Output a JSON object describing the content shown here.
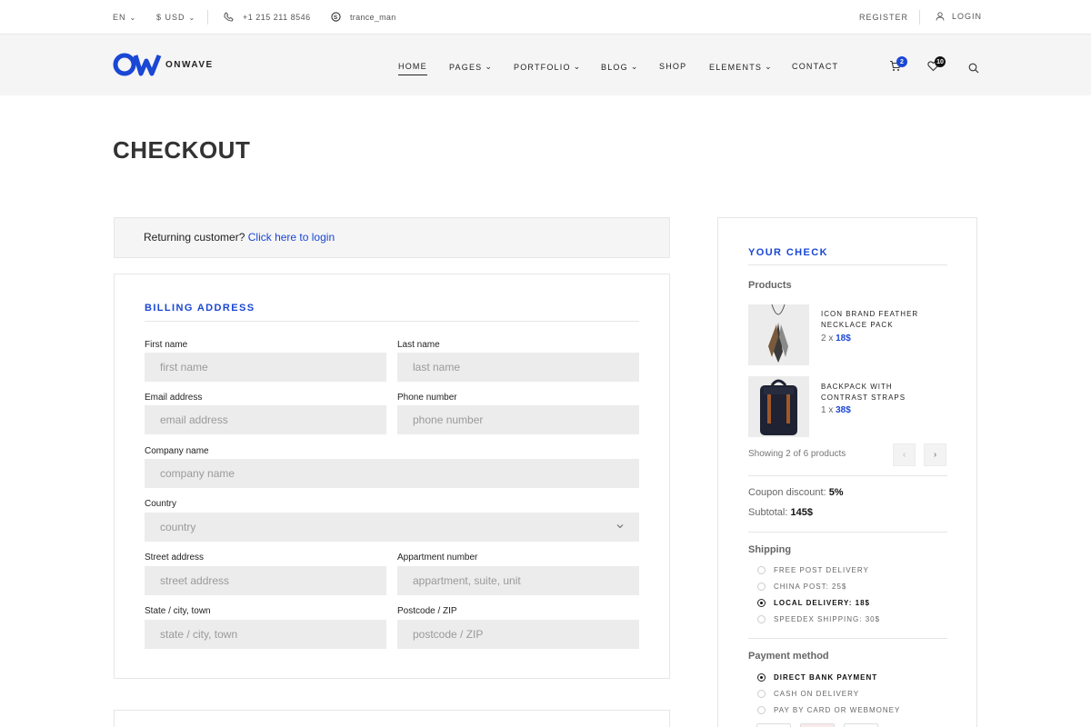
{
  "topbar": {
    "lang": "EN",
    "currency": "$ USD",
    "phone": "+1 215 211 8546",
    "skype": "trance_man",
    "register": "REGISTER",
    "login": "LOGIN"
  },
  "header": {
    "logo_text": "ONWAVE",
    "nav": {
      "home": "HOME",
      "pages": "PAGES",
      "portfolio": "PORTFOLIO",
      "blog": "BLOG",
      "shop": "SHOP",
      "elements": "ELEMENTS",
      "contact": "CONTACT"
    },
    "cart_count": "2",
    "wishlist_count": "10"
  },
  "page": {
    "title": "CHECKOUT",
    "returning_text": "Returning customer?",
    "returning_link": "Click here to login"
  },
  "billing": {
    "title": "BILLING ADDRESS",
    "fields": {
      "first_name": {
        "label": "First name",
        "placeholder": "first name"
      },
      "last_name": {
        "label": "Last name",
        "placeholder": "last name"
      },
      "email": {
        "label": "Email address",
        "placeholder": "email address"
      },
      "phone": {
        "label": "Phone number",
        "placeholder": "phone number"
      },
      "company": {
        "label": "Company name",
        "placeholder": "company name"
      },
      "country": {
        "label": "Country",
        "placeholder": "country"
      },
      "street": {
        "label": "Street address",
        "placeholder": "street address"
      },
      "apartment": {
        "label": "Appartment number",
        "placeholder": "appartment, suite, unit"
      },
      "city": {
        "label": "State / city, town",
        "placeholder": "state / city, town"
      },
      "postcode": {
        "label": "Postcode / ZIP",
        "placeholder": "postcode / ZIP"
      }
    }
  },
  "check": {
    "title": "YOUR CHECK",
    "products_heading": "Products",
    "products": [
      {
        "name": "ICON BRAND FEATHER NECKLACE PACK",
        "qty": "2 x",
        "price": "18$"
      },
      {
        "name": "BACKPACK WITH CONTRAST STRAPS",
        "qty": "1 x",
        "price": "38$"
      }
    ],
    "showing": "Showing 2 of 6 products",
    "coupon_label": "Coupon discount:",
    "coupon_value": "5%",
    "subtotal_label": "Subtotal:",
    "subtotal_value": "145$",
    "shipping_heading": "Shipping",
    "shipping_options": [
      {
        "label": "FREE POST DELIVERY",
        "selected": false
      },
      {
        "label": "CHINA POST: 25$",
        "selected": false
      },
      {
        "label": "LOCAL DELIVERY: 18$",
        "selected": true
      },
      {
        "label": "SPEEDEX SHIPPING: 30$",
        "selected": false
      }
    ],
    "payment_heading": "Payment method",
    "payment_options": [
      {
        "label": "DIRECT BANK PAYMENT",
        "selected": true
      },
      {
        "label": "CASH ON DELIVERY",
        "selected": false
      },
      {
        "label": "PAY BY CARD OR WEBMONEY",
        "selected": false
      }
    ]
  },
  "colors": {
    "accent": "#1a47d4",
    "badge_cart": "#1a47d4",
    "badge_wishlist": "#111111"
  }
}
